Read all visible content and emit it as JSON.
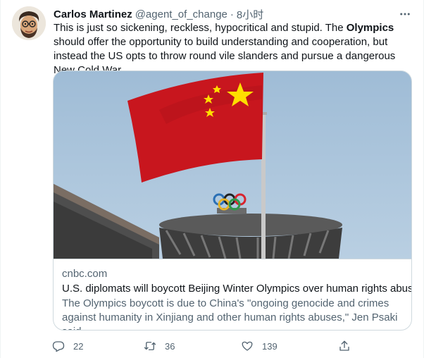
{
  "tweet": {
    "author_name": "Carlos Martinez",
    "author_handle": "@agent_of_change",
    "separator": "·",
    "time": "8小时",
    "text_1": "This is just so sickening, reckless, hypocritical and stupid. The ",
    "text_bold": "Olympics",
    "text_2": " should offer the opportunity to build understanding and cooperation, but instead the US opts to throw round vile slanders and pursue a dangerous New Cold War."
  },
  "card": {
    "domain": "cnbc.com",
    "title": "U.S. diplomats will boycott Beijing Winter Olympics over human rights abuses",
    "description": "The Olympics boycott is due to China's \"ongoing genocide and crimes against humanity in Xinjiang and other human rights abuses,\" Jen Psaki said."
  },
  "actions": {
    "reply_count": "22",
    "retweet_count": "36",
    "like_count": "139"
  },
  "icons": {
    "more": "more-icon",
    "reply": "reply-icon",
    "retweet": "retweet-icon",
    "like": "heart-icon",
    "share": "share-icon"
  },
  "colors": {
    "text_primary": "#0f1419",
    "text_secondary": "#536471",
    "border": "#cfd9de",
    "flag_red": "#c8161e",
    "flag_star": "#ffde00"
  }
}
